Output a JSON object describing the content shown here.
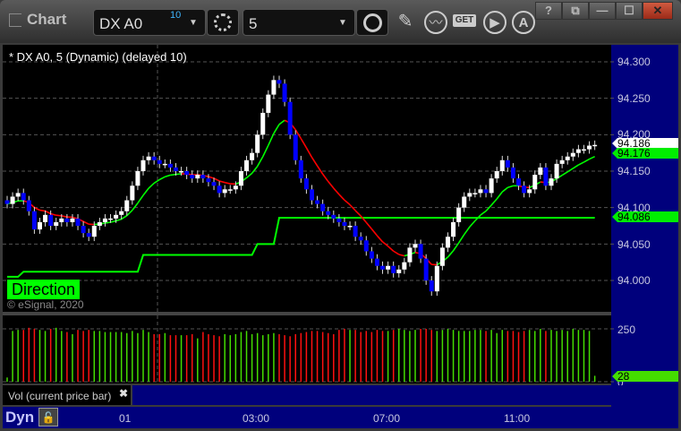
{
  "window": {
    "title": "Chart",
    "help": "?",
    "minimize": "—",
    "maximize": "☐",
    "close": "✕"
  },
  "toolbar": {
    "symbol": "DX A0",
    "symbol_badge": "10",
    "interval": "5",
    "icons": [
      "gear-icon",
      "clock-icon",
      "pencil-icon",
      "study-icon",
      "get-icon",
      "play-icon",
      "alert-icon"
    ],
    "get_label": "GET"
  },
  "chart": {
    "title": "* DX A0, 5 (Dynamic) (delayed 10)",
    "direction_label": "Direction",
    "copyright": "© eSignal, 2020",
    "price_ticks": [
      "94.300",
      "94.250",
      "94.200",
      "94.150",
      "94.100",
      "94.050",
      "94.000"
    ],
    "last_price": "94.186",
    "ma_value": "94.176",
    "direction_value": "94.086"
  },
  "volume": {
    "label": "Vol (current price bar)",
    "close": "✖",
    "ticks": [
      "250",
      "0"
    ],
    "last": "28"
  },
  "time_axis": {
    "labels": [
      "01",
      "03:00",
      "07:00",
      "11:00"
    ],
    "mode": "Dyn"
  },
  "colors": {
    "up_candle": "#ffffff",
    "down_candle": "#0000ff",
    "ma_up": "#00ff00",
    "ma_down": "#ff0000",
    "direction": "#00ff00",
    "vol_up": "#44dd00",
    "vol_down": "#ff1010",
    "axis_bg": "#00007c"
  },
  "chart_data": {
    "type": "candlestick",
    "ylim": [
      93.97,
      94.32
    ],
    "closes": [
      94.105,
      94.115,
      94.12,
      94.11,
      94.095,
      94.07,
      94.08,
      94.09,
      94.075,
      94.08,
      94.085,
      94.08,
      94.085,
      94.075,
      94.065,
      94.06,
      94.075,
      94.08,
      94.085,
      94.085,
      94.09,
      94.095,
      94.11,
      94.13,
      94.15,
      94.165,
      94.17,
      94.165,
      94.16,
      94.16,
      94.155,
      94.15,
      94.15,
      94.145,
      94.14,
      94.145,
      94.14,
      94.135,
      94.13,
      94.12,
      94.125,
      94.125,
      94.13,
      94.15,
      94.165,
      94.175,
      94.2,
      94.23,
      94.255,
      94.275,
      94.27,
      94.245,
      94.2,
      94.165,
      94.14,
      94.125,
      94.11,
      94.105,
      94.095,
      94.09,
      94.085,
      94.08,
      94.075,
      94.075,
      94.06,
      94.055,
      94.04,
      94.03,
      94.02,
      94.015,
      94.02,
      94.01,
      94.015,
      94.025,
      94.045,
      94.05,
      94.03,
      94.0,
      93.985,
      94.02,
      94.045,
      94.06,
      94.08,
      94.1,
      94.115,
      94.12,
      94.12,
      94.125,
      94.12,
      94.14,
      94.15,
      94.165,
      94.155,
      94.14,
      94.13,
      94.12,
      94.125,
      94.145,
      94.155,
      94.13,
      94.14,
      94.16,
      94.165,
      94.17,
      94.175,
      94.18,
      94.18,
      94.185,
      94.186
    ],
    "direction_steps": [
      [
        0,
        94.005
      ],
      [
        3,
        94.012
      ],
      [
        25,
        94.035
      ],
      [
        46,
        94.05
      ],
      [
        50,
        94.086
      ]
    ],
    "volume": [
      20,
      240,
      245,
      245,
      255,
      250,
      245,
      240,
      250,
      255,
      240,
      235,
      225,
      245,
      240,
      245,
      240,
      240,
      235,
      235,
      235,
      235,
      230,
      240,
      230,
      245,
      235,
      225,
      225,
      230,
      220,
      220,
      220,
      220,
      225,
      205,
      235,
      225,
      220,
      215,
      225,
      220,
      225,
      235,
      240,
      225,
      230,
      220,
      225,
      230,
      225,
      220,
      215,
      225,
      230,
      235,
      240,
      240,
      235,
      230,
      225,
      245,
      250,
      245,
      245,
      235,
      240,
      235,
      245,
      240,
      240,
      245,
      250,
      245,
      240,
      245,
      250,
      250,
      245,
      240,
      245,
      250,
      245,
      240,
      240,
      240,
      245,
      245,
      240,
      245,
      230,
      245,
      240,
      240,
      235,
      240,
      245,
      240,
      250,
      240,
      245,
      240,
      245,
      240,
      250,
      245,
      245,
      240,
      28
    ],
    "volume_ylim": [
      0,
      250
    ],
    "time_labels": [
      "01",
      "03:00",
      "07:00",
      "11:00"
    ]
  }
}
